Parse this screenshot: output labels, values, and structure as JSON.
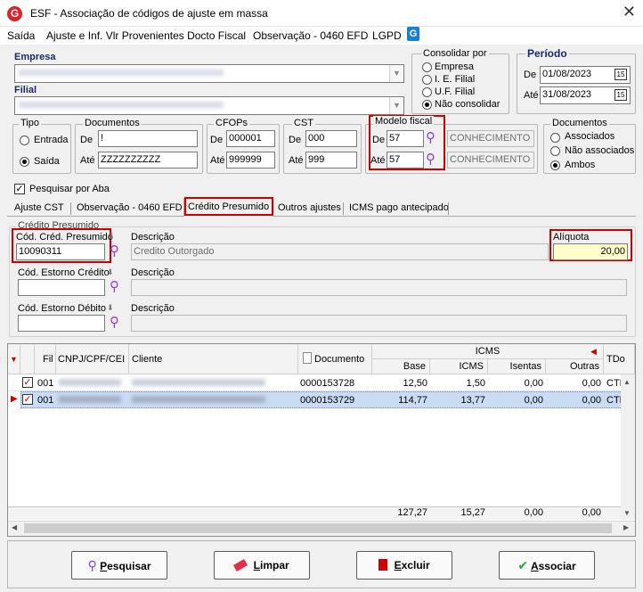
{
  "window": {
    "title": "ESF - Associação de códigos de ajuste em massa",
    "close_glyph": "✕",
    "app_glyph": "G"
  },
  "menu": {
    "items": [
      "Saída",
      "Ajuste e Inf. Vlr Provenientes Docto Fiscal",
      "Observação - 0460 EFD",
      "LGPD"
    ],
    "lgpd_glyph": "G"
  },
  "empresa": {
    "label": "Empresa"
  },
  "filial": {
    "label": "Filial"
  },
  "consolidar": {
    "title": "Consolidar por",
    "options": [
      "Empresa",
      "I. E. Filial",
      "U.F. Filial",
      "Não consolidar"
    ],
    "selected": "Não consolidar"
  },
  "periodo": {
    "title": "Período",
    "de_label": "De",
    "ate_label": "Até",
    "de": "01/08/2023",
    "ate": "31/08/2023"
  },
  "tipo": {
    "title": "Tipo",
    "options": [
      "Entrada",
      "Saída"
    ],
    "selected": "Saída"
  },
  "documentos": {
    "title": "Documentos",
    "de_label": "De",
    "ate_label": "Até",
    "de": "!",
    "ate": "ZZZZZZZZZZ"
  },
  "cfops": {
    "title": "CFOPs",
    "de_label": "De",
    "ate_label": "Até",
    "de": "000001",
    "ate": "999999"
  },
  "cst": {
    "title": "CST",
    "de_label": "De",
    "ate_label": "Até",
    "de": "000",
    "ate": "999"
  },
  "modelo_fiscal": {
    "title": "Modelo fiscal",
    "de_label": "De",
    "ate_label": "Até",
    "de": "57",
    "ate": "57",
    "de_desc": "CONHECIMENTO D",
    "ate_desc": "CONHECIMENTO D"
  },
  "documentos2": {
    "title": "Documentos",
    "options": [
      "Associados",
      "Não associados",
      "Ambos"
    ],
    "selected": "Ambos"
  },
  "pesquisar_aba": {
    "label": "Pesquisar por Aba",
    "checked": true
  },
  "tabs": [
    {
      "label": "Ajuste CST",
      "active": false
    },
    {
      "label": "Observação - 0460 EFD",
      "active": false
    },
    {
      "label": "Crédito Presumido",
      "active": true
    },
    {
      "label": "Outros ajustes",
      "active": false
    },
    {
      "label": "ICMS pago antecipado",
      "active": false
    }
  ],
  "credito": {
    "group_title": "Crédito Presumido",
    "cod_label": "Cód. Créd. Presumido",
    "cod_value": "10090311",
    "desc_label": "Descrição",
    "desc_value": "Credito Outorgado",
    "aliquota_label": "Alíquota",
    "aliquota_value": "20,00",
    "estorno_credito_label": "Cód. Estorno Crédito",
    "estorno_credito_desc_label": "Descrição",
    "estorno_debito_label": "Cód. Estorno Débito",
    "estorno_debito_desc_label": "Descrição"
  },
  "grid": {
    "headers": {
      "fil": "Fil",
      "cnpj": "CNPJ/CPF/CEI",
      "cliente": "Cliente",
      "documento": "Documento",
      "icms_group": "ICMS",
      "base": "Base",
      "icms": "ICMS",
      "isentas": "Isentas",
      "outras": "Outras",
      "tdoc": "TDo"
    },
    "rows": [
      {
        "fil": "001",
        "documento": "0000153728",
        "base": "12,50",
        "icms": "1,50",
        "isentas": "0,00",
        "outras": "0,00",
        "tdoc": "CTE",
        "checked": true,
        "selected": false
      },
      {
        "fil": "001",
        "documento": "0000153729",
        "base": "114,77",
        "icms": "13,77",
        "isentas": "0,00",
        "outras": "0,00",
        "tdoc": "CTE",
        "checked": true,
        "selected": true
      }
    ],
    "totals": {
      "base": "127,27",
      "icms": "15,27",
      "isentas": "0,00",
      "outras": "0,00"
    }
  },
  "buttons": {
    "pesquisar": {
      "first": "P",
      "rest": "esquisar"
    },
    "limpar": {
      "first": "L",
      "rest": "impar"
    },
    "excluir": {
      "first": "E",
      "rest": "xcluir"
    },
    "associar": {
      "first": "A",
      "rest": "ssociar"
    }
  },
  "colors": {
    "accent_red": "#d00000",
    "selected_row": "#c9dcf3",
    "aliquota_bg": "#ffffcc",
    "search_icon": "#8a3fd8"
  }
}
